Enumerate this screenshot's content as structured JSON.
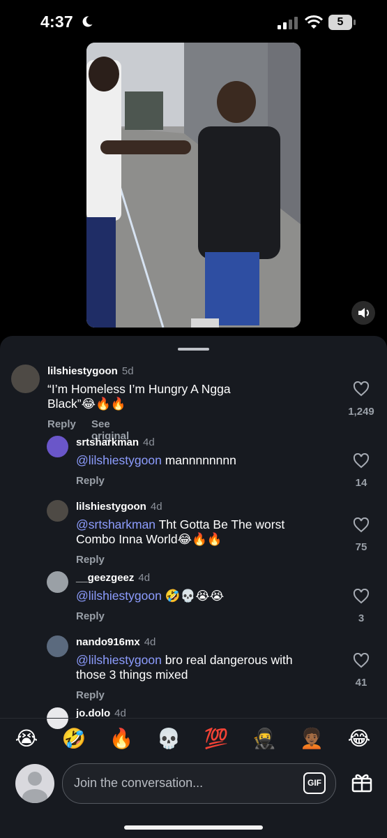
{
  "status": {
    "time": "4:37",
    "battery": "5"
  },
  "comments": [
    {
      "username": "lilshiestygoon",
      "age": "5d",
      "text": "“I’m Homeless I’m Hungry A Ngga Black”😂🔥🔥",
      "likes": "1,249",
      "reply": "Reply",
      "see_original": "See original"
    },
    {
      "username": "srtsharkman",
      "age": "4d",
      "mention": "@lilshiestygoon",
      "text": " mannnnnnnn",
      "likes": "14",
      "reply": "Reply"
    },
    {
      "username": "lilshiestygoon",
      "age": "4d",
      "mention": "@srtsharkman",
      "text": " Tht Gotta Be The worst Combo Inna World😂🔥🔥",
      "likes": "75",
      "reply": "Reply"
    },
    {
      "username": "__geezgeez",
      "age": "4d",
      "mention": "@lilshiestygoon",
      "text": " 🤣💀😭😭",
      "likes": "3",
      "reply": "Reply"
    },
    {
      "username": "nando916mx",
      "age": "4d",
      "mention": "@lilshiestygoon",
      "text": " bro real dangerous with those 3 things mixed",
      "likes": "41",
      "reply": "Reply"
    },
    {
      "username": "jo.dolo",
      "age": "4d"
    }
  ],
  "emoji_bar": [
    "😭",
    "🤣",
    "🔥",
    "💀",
    "💯",
    "🥷",
    "🧑🏾‍🦱",
    "😂"
  ],
  "composer": {
    "placeholder": "Join the conversation...",
    "gif_label": "GIF"
  },
  "icons": [
    "moon-icon",
    "signal-icon",
    "wifi-icon",
    "battery-icon",
    "sound-icon",
    "heart-icon",
    "gif-icon",
    "gift-icon",
    "avatar-placeholder-icon"
  ]
}
